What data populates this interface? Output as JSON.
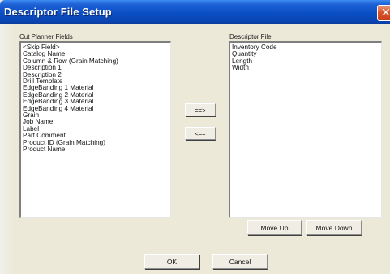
{
  "window": {
    "title": "Descriptor File Setup",
    "close_glyph": "✕"
  },
  "left_panel": {
    "label": "Cut Planner Fields",
    "items": [
      "<Skip Field>",
      "Catalog Name",
      "Column & Row (Grain Matching)",
      "Description 1",
      "Description 2",
      "Drill Template",
      "EdgeBanding 1 Material",
      "EdgeBanding 2 Material",
      "EdgeBanding 3 Material",
      "EdgeBanding 4 Material",
      "Grain",
      "Job Name",
      "Label",
      "Part Comment",
      "Product ID (Grain Matching)",
      "Product Name"
    ]
  },
  "right_panel": {
    "label": "Descriptor File",
    "items": [
      "Inventory Code",
      "Quantity",
      "Length",
      "Width"
    ]
  },
  "buttons": {
    "add": "==>",
    "remove": "<==",
    "move_up": "Move Up",
    "move_down": "Move Down",
    "ok": "OK",
    "cancel": "Cancel"
  },
  "colors": {
    "titlebar": "#0a4ec4",
    "close": "#d9542a",
    "dialog_bg": "#ece9d8"
  },
  "icons": {
    "close": "close-icon"
  }
}
